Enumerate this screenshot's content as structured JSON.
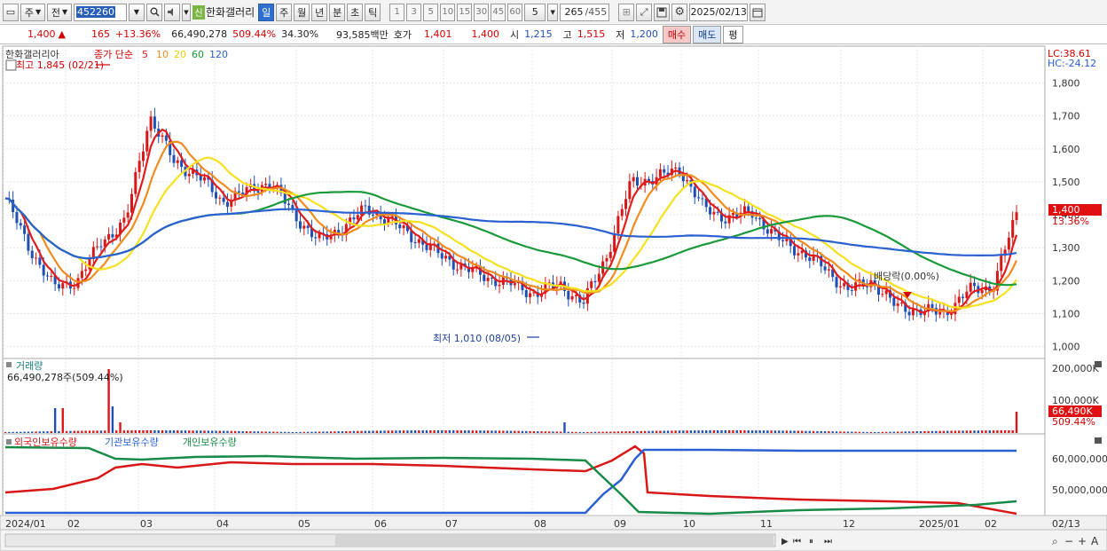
{
  "toolbar": {
    "freq_type": "주",
    "prev_label": "전",
    "stock_code": "452260",
    "stock_name": "한화갤러리",
    "new_badge": "신",
    "periods": [
      "일",
      "주",
      "월",
      "년",
      "분",
      "초",
      "틱"
    ],
    "active_period": "일",
    "intervals": [
      "1",
      "3",
      "5",
      "10",
      "15",
      "30",
      "45",
      "60"
    ],
    "custom_interval": "5",
    "bar_count": "265",
    "bar_total": "/455",
    "date": "2025/02/13"
  },
  "quote": {
    "price": "1,400",
    "change": "165",
    "change_pct": "+13.36%",
    "volume": "66,490,278",
    "volume_pct": "509.44%",
    "turnover": "34.30%",
    "amount": "93,585백만",
    "bid_label": "호가",
    "bid": "1,401",
    "ask": "1,400",
    "open_label": "시",
    "open": "1,215",
    "high_label": "고",
    "high": "1,515",
    "low_label": "저",
    "low": "1,200",
    "buy_label": "매수",
    "sell_label": "매도",
    "eval_label": "평"
  },
  "price_panel": {
    "name": "한화갤러리아",
    "legend_prefix": "종가 단순",
    "ma_labels": [
      "5",
      "10",
      "20",
      "60",
      "120"
    ],
    "high_marker": "최고 1,845 (02/21)",
    "low_marker": "최저 1,010 (08/05)",
    "dividend_marker": "배당락(0.00%)",
    "lc": "LC:38.61",
    "hc": "HC:-24.12",
    "price_axis": [
      "1,800",
      "1,700",
      "1,600",
      "1,500",
      "1,400",
      "1,300",
      "1,200",
      "1,100",
      "1,000"
    ],
    "current_price_tag": "1,400",
    "current_pct_tag": "13.36%"
  },
  "volume_panel": {
    "title": "거래량",
    "value_text": "66,490,278주(509.44%)",
    "axis": [
      "200,000K",
      "100,000K"
    ],
    "current_tag": "66,490K",
    "current_pct": "509.44%"
  },
  "holdings_panel": {
    "legend": [
      "외국인보유수량",
      "기관보유수량",
      "개인보유수량"
    ],
    "axis": [
      "60,000,000",
      "50,000,000"
    ]
  },
  "date_axis": [
    "2024/01",
    "02",
    "03",
    "04",
    "05",
    "06",
    "07",
    "08",
    "09",
    "10",
    "11",
    "12",
    "2025/01",
    "02"
  ],
  "date_axis_right": "02/13",
  "colors": {
    "candle_up": "#d81818",
    "candle_down": "#1f4fb5",
    "ma5": "#e21c1c",
    "ma10": "#f08c1e",
    "ma20": "#f5e11e",
    "ma60": "#1a9a3a",
    "ma120": "#2a60d0",
    "foreign": "#d81818",
    "institution": "#2a60d0",
    "individual": "#1a8a48"
  },
  "chart_data": {
    "type": "line",
    "price_ylim": [
      980,
      1850
    ],
    "close": [
      [
        "2024/01",
        1450
      ],
      [
        "2024/01",
        1300
      ],
      [
        "2024/01",
        1180
      ],
      [
        "2024/02",
        1200
      ],
      [
        "2024/02",
        1320
      ],
      [
        "2024/02",
        1380
      ],
      [
        "2024/02",
        1700
      ],
      [
        "2024/02",
        1560
      ],
      [
        "2024/03",
        1520
      ],
      [
        "2024/03",
        1440
      ],
      [
        "2024/03",
        1470
      ],
      [
        "2024/04",
        1500
      ],
      [
        "2024/04",
        1400
      ],
      [
        "2024/04",
        1320
      ],
      [
        "2024/05",
        1360
      ],
      [
        "2024/05",
        1420
      ],
      [
        "2024/05",
        1380
      ],
      [
        "2024/06",
        1330
      ],
      [
        "2024/06",
        1280
      ],
      [
        "2024/06",
        1240
      ],
      [
        "2024/07",
        1210
      ],
      [
        "2024/07",
        1190
      ],
      [
        "2024/07",
        1160
      ],
      [
        "2024/08",
        1190
      ],
      [
        "2024/08",
        1130
      ],
      [
        "2024/08",
        1280
      ],
      [
        "2024/08",
        1500
      ],
      [
        "2024/09",
        1510
      ],
      [
        "2024/09",
        1540
      ],
      [
        "2024/09",
        1420
      ],
      [
        "2024/10",
        1390
      ],
      [
        "2024/10",
        1410
      ],
      [
        "2024/10",
        1330
      ],
      [
        "2024/11",
        1290
      ],
      [
        "2024/11",
        1240
      ],
      [
        "2024/11",
        1170
      ],
      [
        "2024/12",
        1200
      ],
      [
        "2024/12",
        1120
      ],
      [
        "2024/12",
        1110
      ],
      [
        "2025/01",
        1100
      ],
      [
        "2025/01",
        1170
      ],
      [
        "2025/02",
        1180
      ],
      [
        "2025/02/13",
        1400
      ]
    ]
  }
}
